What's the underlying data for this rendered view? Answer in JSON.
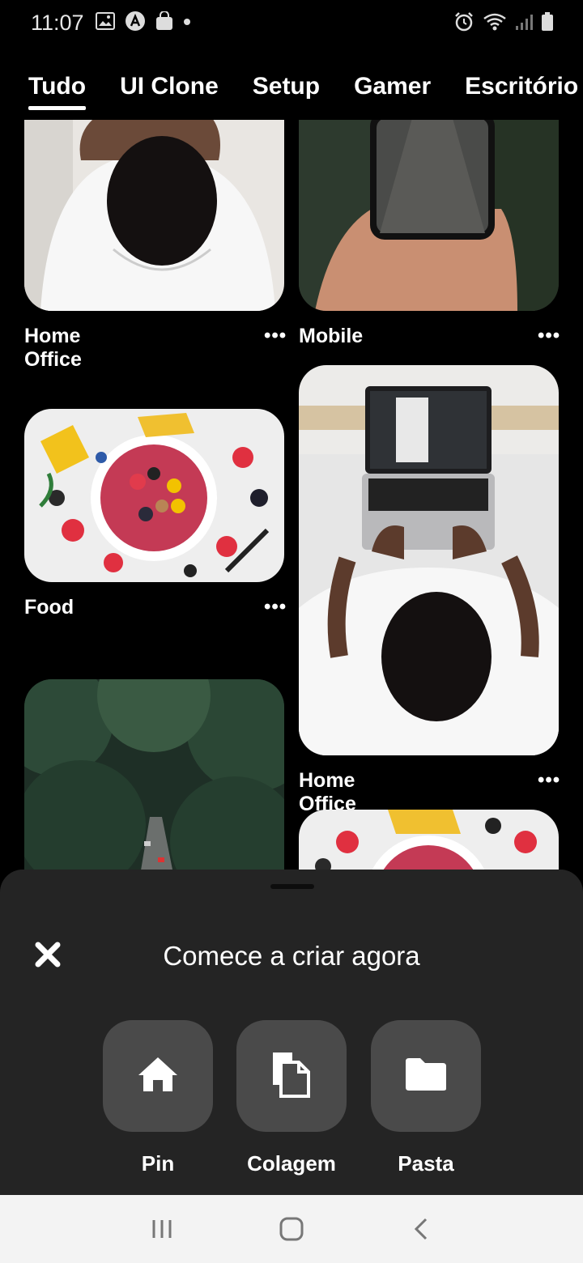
{
  "status_bar": {
    "time": "11:07",
    "left_icons": [
      "gallery-icon",
      "app-icon",
      "shopping-bag-icon",
      "dot-icon"
    ],
    "right_icons": [
      "alarm-icon",
      "wifi-icon",
      "signal-icon",
      "battery-icon"
    ]
  },
  "tabs": [
    {
      "label": "Tudo",
      "active": true
    },
    {
      "label": "UI Clone",
      "active": false
    },
    {
      "label": "Setup",
      "active": false
    },
    {
      "label": "Gamer",
      "active": false
    },
    {
      "label": "Escritório",
      "active": false
    }
  ],
  "feed": {
    "cards": [
      {
        "title": "Home Office",
        "more": "•••",
        "image": "person-top-view-photo"
      },
      {
        "title": "Mobile",
        "more": "•••",
        "image": "phone-over-road-photo"
      },
      {
        "title": "Food",
        "more": "•••",
        "image": "fruit-bowl-photo"
      },
      {
        "title": "Home Office",
        "more": "•••",
        "image": "person-laptop-photo"
      },
      {
        "title": "",
        "more": "",
        "image": "forest-road-photo"
      },
      {
        "title": "",
        "more": "",
        "image": "fruit-bowl-photo"
      }
    ]
  },
  "sheet": {
    "title": "Comece a criar agora",
    "close_icon": "close-icon",
    "actions": [
      {
        "label": "Pin",
        "icon": "home-icon"
      },
      {
        "label": "Colagem",
        "icon": "collage-icon"
      },
      {
        "label": "Pasta",
        "icon": "folder-icon"
      }
    ]
  },
  "nav_bar": {
    "buttons": [
      "recent-apps-icon",
      "home-button-icon",
      "back-icon"
    ]
  },
  "colors": {
    "background": "#000000",
    "sheet": "#242424",
    "tile": "#4a4a4a",
    "navbar": "#f3f3f3"
  }
}
